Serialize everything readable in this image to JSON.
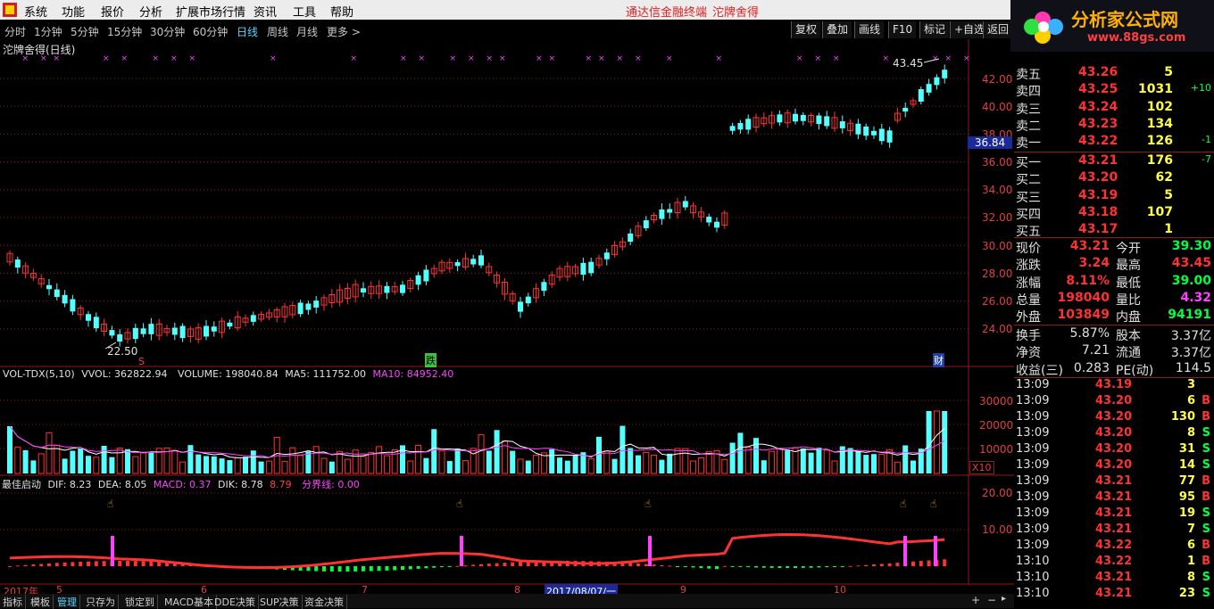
{
  "menu": {
    "items": [
      "系统",
      "功能",
      "报价",
      "分析",
      "扩展市场行情",
      "资讯",
      "工具",
      "帮助"
    ],
    "app_title": "通达信金融终端",
    "stock_name": "沱牌舍得"
  },
  "logo": {
    "name": "分析家公式网",
    "url_text": "www.88gs.com"
  },
  "periods": {
    "items": [
      "分时",
      "1分钟",
      "5分钟",
      "15分钟",
      "30分钟",
      "60分钟",
      "日线",
      "周线",
      "月线",
      "更多 >"
    ],
    "active_index": 6
  },
  "toolbar": {
    "buttons": [
      "复权",
      "叠加",
      "画线",
      "F10",
      "标记",
      "+自选",
      "返回"
    ]
  },
  "main_chart": {
    "title": "沱牌舍得(日线)",
    "price_axis": [
      "42.00",
      "40.00",
      "38.00",
      "36.00",
      "34.00",
      "32.00",
      "30.00",
      "28.00",
      "26.00",
      "24.00"
    ],
    "current_price_label": "36.84",
    "high_label": "43.45",
    "low_label": "22.50",
    "markers": {
      "s": "S",
      "die": "跌",
      "cai": "财"
    }
  },
  "volume": {
    "name": "VOL-TDX(5,10)",
    "vvol": "VVOL: 362822.94",
    "volume": "VOLUME: 198040.84",
    "ma5": "MA5: 111752.00",
    "ma10": "MA10: 84952.40",
    "axis": [
      "30000",
      "20000",
      "10000"
    ],
    "unit": "X10"
  },
  "macd": {
    "name": "最佳启动",
    "dif": "DIF: 8.23",
    "dea": "DEA: 8.05",
    "macd": "MACD: 0.37",
    "dik": "DIK: 8.78",
    "dik_val": "8.79",
    "boundary": "分界线: 0.00",
    "axis": [
      "20.00",
      "10.00"
    ]
  },
  "date_axis": {
    "year": "2017年",
    "months": [
      "5",
      "6",
      "7",
      "8",
      "9",
      "10"
    ],
    "cursor_date": "2017/08/07/一"
  },
  "bottom_tabs": [
    "指标",
    "模板",
    "管理",
    "只存为",
    "锁定到",
    "MACD基本",
    "DDE决策",
    "SUP决策",
    "资金决策"
  ],
  "colors": {
    "up": "#ff3232",
    "down": "#54ffff",
    "magenta": "#ff40ff",
    "yellow": "#ffff00",
    "green": "#00ff40",
    "grid": "#8b1a1a"
  },
  "quote": {
    "sell": [
      {
        "label": "卖五",
        "price": "43.26",
        "vol": "5",
        "chg": ""
      },
      {
        "label": "卖四",
        "price": "43.25",
        "vol": "1031",
        "chg": "+10"
      },
      {
        "label": "卖三",
        "price": "43.24",
        "vol": "102",
        "chg": ""
      },
      {
        "label": "卖二",
        "price": "43.23",
        "vol": "134",
        "chg": ""
      },
      {
        "label": "卖一",
        "price": "43.22",
        "vol": "126",
        "chg": "-1"
      }
    ],
    "buy": [
      {
        "label": "买一",
        "price": "43.21",
        "vol": "176",
        "chg": "-7"
      },
      {
        "label": "买二",
        "price": "43.20",
        "vol": "62",
        "chg": ""
      },
      {
        "label": "买三",
        "price": "43.19",
        "vol": "5",
        "chg": ""
      },
      {
        "label": "买四",
        "price": "43.18",
        "vol": "107",
        "chg": ""
      },
      {
        "label": "买五",
        "price": "43.17",
        "vol": "1",
        "chg": ""
      }
    ],
    "stats": [
      {
        "l1": "现价",
        "v1": "43.21",
        "l2": "今开",
        "v2": "39.30"
      },
      {
        "l1": "涨跌",
        "v1": "3.24",
        "l2": "最高",
        "v2": "43.45"
      },
      {
        "l1": "涨幅",
        "v1": "8.11%",
        "l2": "最低",
        "v2": "39.00"
      },
      {
        "l1": "总量",
        "v1": "198040",
        "l2": "量比",
        "v2": "4.32"
      },
      {
        "l1": "外盘",
        "v1": "103849",
        "l2": "内盘",
        "v2": "94191"
      }
    ],
    "fundamentals": [
      {
        "l1": "换手",
        "v1": "5.87%",
        "l2": "股本",
        "v2": "3.37亿"
      },
      {
        "l1": "净资",
        "v1": "7.21",
        "l2": "流通",
        "v2": "3.37亿"
      },
      {
        "l1": "收益(三)",
        "v1": "0.283",
        "l2": "PE(动)",
        "v2": "114.5"
      }
    ],
    "ticks": [
      {
        "time": "13:09",
        "price": "43.19",
        "vol": "3",
        "side": ""
      },
      {
        "time": "13:09",
        "price": "43.20",
        "vol": "6",
        "side": "B"
      },
      {
        "time": "13:09",
        "price": "43.20",
        "vol": "130",
        "side": "B"
      },
      {
        "time": "13:09",
        "price": "43.20",
        "vol": "8",
        "side": "S"
      },
      {
        "time": "13:09",
        "price": "43.20",
        "vol": "31",
        "side": "S"
      },
      {
        "time": "13:09",
        "price": "43.20",
        "vol": "14",
        "side": "S"
      },
      {
        "time": "13:09",
        "price": "43.21",
        "vol": "77",
        "side": "B"
      },
      {
        "time": "13:09",
        "price": "43.21",
        "vol": "95",
        "side": "B"
      },
      {
        "time": "13:09",
        "price": "43.21",
        "vol": "19",
        "side": "S"
      },
      {
        "time": "13:09",
        "price": "43.21",
        "vol": "7",
        "side": "S"
      },
      {
        "time": "13:09",
        "price": "43.22",
        "vol": "6",
        "side": "B"
      },
      {
        "time": "13:10",
        "price": "43.22",
        "vol": "1",
        "side": "B"
      },
      {
        "time": "13:10",
        "price": "43.21",
        "vol": "8",
        "side": "S"
      },
      {
        "time": "13:10",
        "price": "43.21",
        "vol": "23",
        "side": "S"
      }
    ]
  }
}
